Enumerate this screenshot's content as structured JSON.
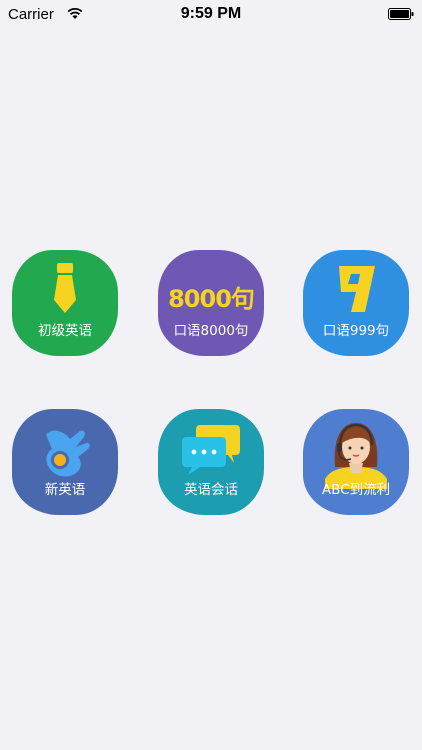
{
  "status_bar": {
    "carrier": "Carrier",
    "time": "9:59 PM"
  },
  "apps": [
    {
      "label": "初级英语",
      "icon": "necktie-icon",
      "color": "#22a84f"
    },
    {
      "label": "口语8000句",
      "icon": "8000-句-logo-icon",
      "color": "#6f58b4"
    },
    {
      "label": "口语999句",
      "icon": "number-9-icon",
      "color": "#2f8fe0"
    },
    {
      "label": "新英语",
      "icon": "ok-hand-icon",
      "color": "#4a68ae"
    },
    {
      "label": "英语会话",
      "icon": "chat-bubbles-icon",
      "color": "#1d9eb0"
    },
    {
      "label": "ABC到流利",
      "icon": "headset-agent-icon",
      "color": "#4f7ed1"
    }
  ],
  "logo_text": "8000句"
}
